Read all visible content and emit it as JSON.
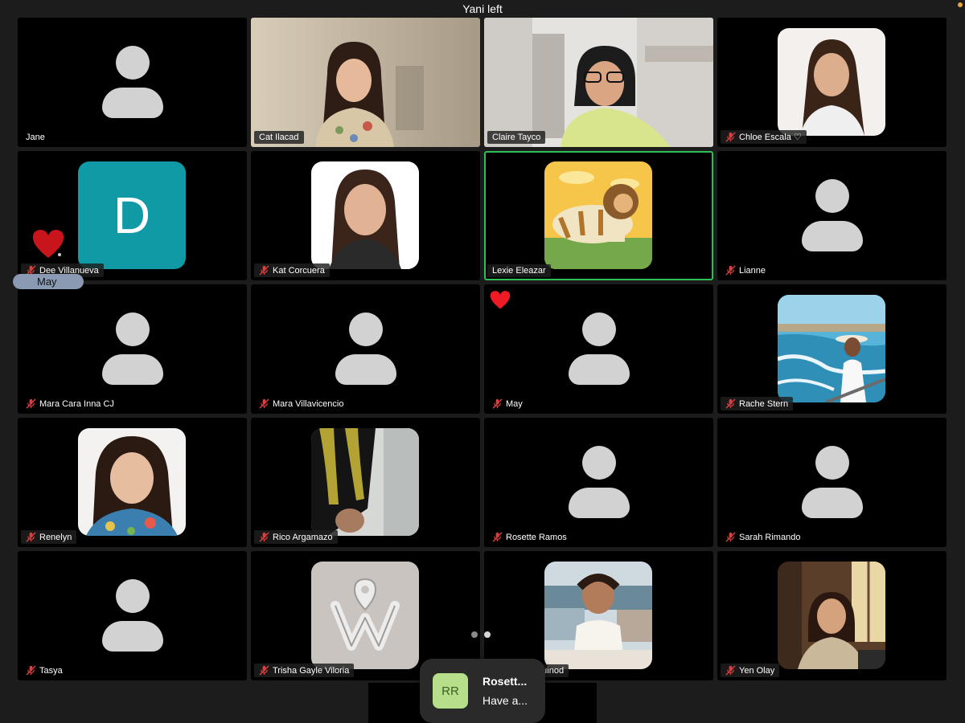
{
  "banner": {
    "text": "Yani left"
  },
  "colors": {
    "background": "#1c1c1c",
    "tile": "#000000",
    "active_border": "#2fbf54",
    "placeholder": "#d2d2d2",
    "name_tag": "#1e1e1e",
    "notification": "#2a2a2a"
  },
  "participants": [
    {
      "name": "Jane",
      "muted": false,
      "kind": "placeholder"
    },
    {
      "name": "Cat Ilacad",
      "muted": false,
      "kind": "video"
    },
    {
      "name": "Claire Tayco",
      "muted": false,
      "kind": "video"
    },
    {
      "name": "Chloe Escala ♡",
      "muted": true,
      "kind": "photo"
    },
    {
      "name": "Dee Villanueva",
      "muted": true,
      "kind": "initial",
      "initial": "D",
      "initial_color": "#0f9aa6"
    },
    {
      "name": "Kat Corcuera",
      "muted": true,
      "kind": "photo"
    },
    {
      "name": "Lexie Eleazar",
      "muted": false,
      "kind": "photo",
      "active": true
    },
    {
      "name": "Lianne",
      "muted": true,
      "kind": "placeholder"
    },
    {
      "name": "Mara Cara Inna CJ",
      "muted": true,
      "kind": "placeholder"
    },
    {
      "name": "Mara Villavicencio",
      "muted": true,
      "kind": "placeholder"
    },
    {
      "name": "May",
      "muted": true,
      "kind": "placeholder"
    },
    {
      "name": "Rache Stern",
      "muted": true,
      "kind": "photo"
    },
    {
      "name": "Renelyn",
      "muted": true,
      "kind": "photo"
    },
    {
      "name": "Rico Argamazo",
      "muted": true,
      "kind": "photo"
    },
    {
      "name": "Rosette Ramos",
      "muted": true,
      "kind": "placeholder"
    },
    {
      "name": "Sarah Rimando",
      "muted": true,
      "kind": "placeholder"
    },
    {
      "name": "Tasya",
      "muted": true,
      "kind": "placeholder"
    },
    {
      "name": "Trisha Gayle Viloria",
      "muted": true,
      "kind": "photo"
    },
    {
      "name": "Matthew Taguinod",
      "muted": false,
      "kind": "photo"
    },
    {
      "name": "Yen Olay",
      "muted": true,
      "kind": "photo"
    }
  ],
  "reactions": {
    "hover_label": "May",
    "icons": [
      "heart-icon",
      "heart-icon"
    ]
  },
  "pagination": {
    "pages": 2,
    "current": 2
  },
  "notification": {
    "avatar_initials": "RR",
    "title": "Rosett...",
    "message": "Have a..."
  }
}
